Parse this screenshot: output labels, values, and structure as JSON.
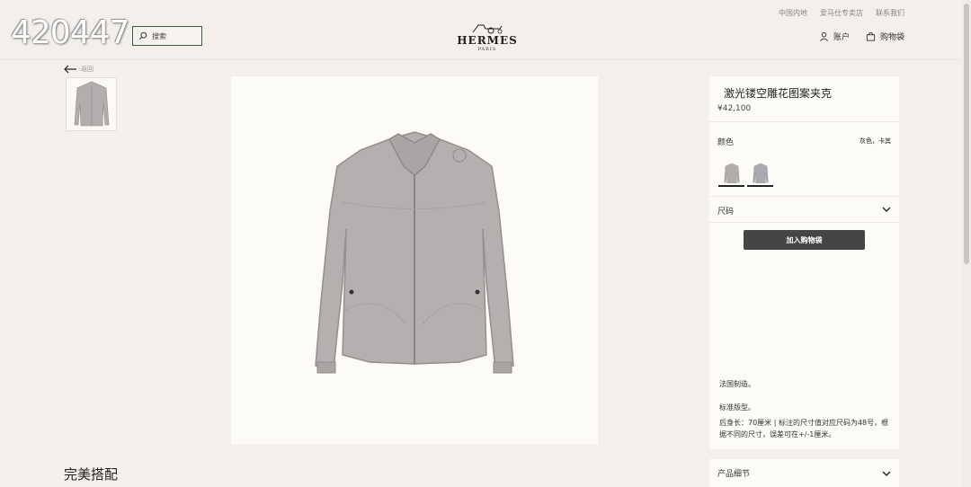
{
  "watermark": "420447",
  "header": {
    "top_links": [
      "中国内地",
      "爱马仕专卖店",
      "联系我们"
    ],
    "search_placeholder": "搜索",
    "logo_brand": "HERMES",
    "logo_city": "PARIS",
    "account_label": "账户",
    "cart_label": "购物袋"
  },
  "back_label": "返回",
  "product": {
    "title": "激光镂空雕花图案夹克",
    "price": "¥42,100",
    "color_label": "颜色",
    "color_value": "灰色，卡其",
    "size_label": "尺码",
    "add_to_bag": "加入购物袋",
    "description": [
      "法国制造。",
      "标准版型。",
      "后身长：70厘米 | 标注的尺寸值对应尺码为48号，根据不同的尺寸，误差可在+/-1厘米。"
    ],
    "details_label": "产品细节"
  },
  "section_title": "完美搭配",
  "icons": {
    "search": "search-icon",
    "account": "user-icon",
    "cart": "bag-icon",
    "back": "arrow-left-icon",
    "chevron": "chevron-down-icon"
  },
  "colors": {
    "page_bg": "#f3efea",
    "panel_bg": "#fdfbf7",
    "button_bg": "#454545",
    "jacket_gray": "#b3aeae"
  }
}
